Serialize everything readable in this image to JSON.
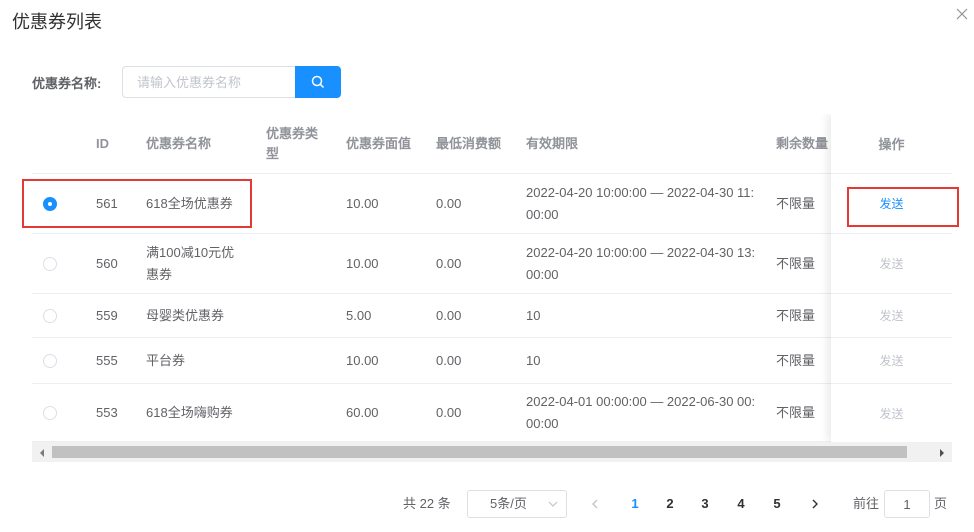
{
  "dialog": {
    "title": "优惠券列表"
  },
  "search": {
    "label": "优惠券名称:",
    "placeholder": "请输入优惠券名称",
    "value": ""
  },
  "table": {
    "headers": {
      "id": "ID",
      "name": "优惠券名称",
      "type_line1": "优惠券类",
      "type_line2": "型",
      "face_value": "优惠券面值",
      "min_spend": "最低消费额",
      "validity": "有效期限",
      "remaining": "剩余数量",
      "action": "操作"
    },
    "rows": [
      {
        "selected": true,
        "id": "561",
        "name_line1": "618全场优惠券",
        "name_line2": "",
        "type": "",
        "face_value": "10.00",
        "min_spend": "0.00",
        "validity_line1": "2022-04-20 10:00:00 — 2022-04-30 11:",
        "validity_line2": "00:00",
        "remaining": "不限量",
        "action": "发送",
        "action_enabled": true
      },
      {
        "selected": false,
        "id": "560",
        "name_line1": "满100减10元优",
        "name_line2": "惠券",
        "type": "",
        "face_value": "10.00",
        "min_spend": "0.00",
        "validity_line1": "2022-04-20 10:00:00 — 2022-04-30 13:",
        "validity_line2": "00:00",
        "remaining": "不限量",
        "action": "发送",
        "action_enabled": false
      },
      {
        "selected": false,
        "id": "559",
        "name_line1": "母婴类优惠券",
        "name_line2": "",
        "type": "",
        "face_value": "5.00",
        "min_spend": "0.00",
        "validity_line1": "10",
        "validity_line2": "",
        "remaining": "不限量",
        "action": "发送",
        "action_enabled": false
      },
      {
        "selected": false,
        "id": "555",
        "name_line1": "平台券",
        "name_line2": "",
        "type": "",
        "face_value": "10.00",
        "min_spend": "0.00",
        "validity_line1": "10",
        "validity_line2": "",
        "remaining": "不限量",
        "action": "发送",
        "action_enabled": false
      },
      {
        "selected": false,
        "id": "553",
        "name_line1": "618全场嗨购券",
        "name_line2": "",
        "type": "",
        "face_value": "60.00",
        "min_spend": "0.00",
        "validity_line1": "2022-04-01 00:00:00 — 2022-06-30 00:",
        "validity_line2": "00:00",
        "remaining": "不限量",
        "action": "发送",
        "action_enabled": false
      }
    ]
  },
  "pagination": {
    "total_text": "共 22 条",
    "page_size": "5条/页",
    "pages": [
      "1",
      "2",
      "3",
      "4",
      "5"
    ],
    "current_page": "1",
    "goto_label": "前往",
    "goto_value": "1",
    "page_unit": "页"
  },
  "colors": {
    "primary": "#1890ff",
    "highlight": "#e53935",
    "disabled": "#c0c4cc"
  },
  "icons": {
    "close": "close-icon",
    "search": "search-icon",
    "chevron_left": "chevron-left-icon",
    "chevron_right": "chevron-right-icon",
    "chevron_down": "chevron-down-icon"
  }
}
